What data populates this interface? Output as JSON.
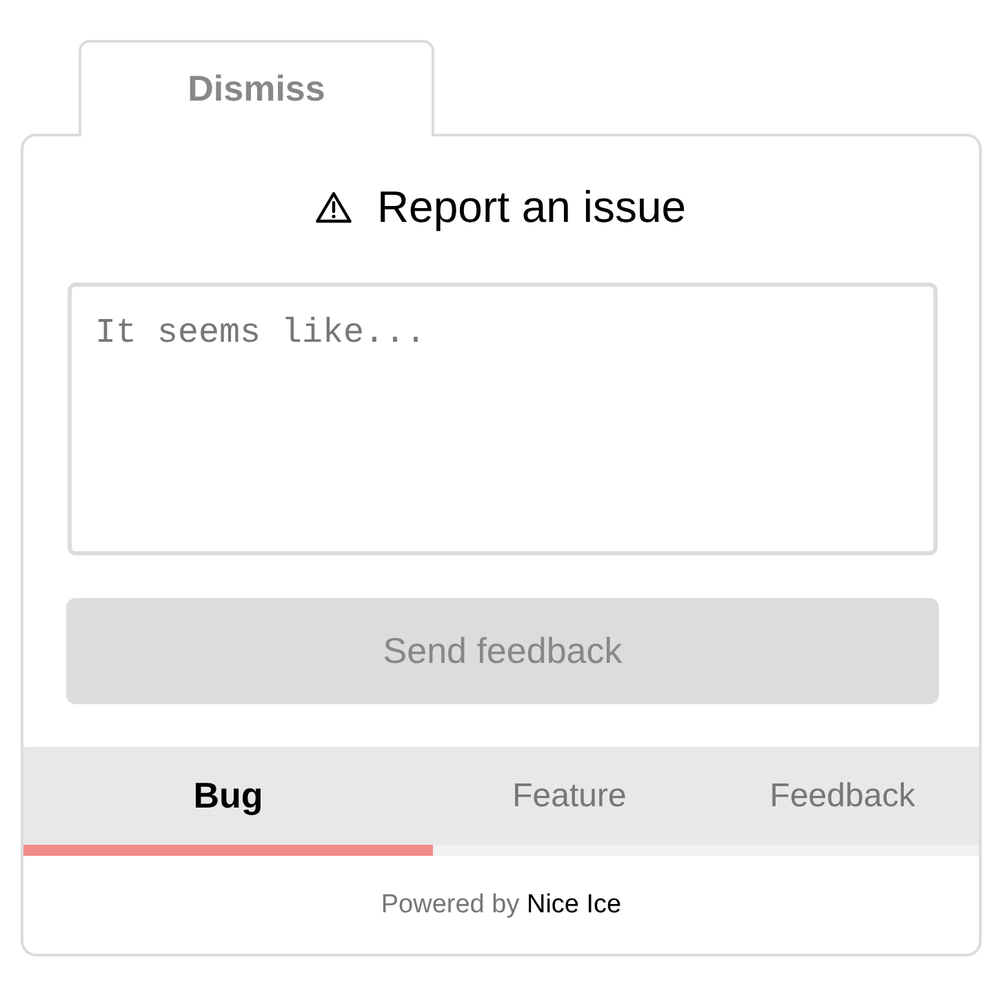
{
  "dismiss_tab": {
    "label": "Dismiss"
  },
  "title": "Report an issue",
  "message_field": {
    "placeholder": "It seems like..."
  },
  "send_button": {
    "label": "Send feedback",
    "disabled": true
  },
  "tabs": [
    {
      "label": "Bug",
      "selected": true
    },
    {
      "label": "Feature",
      "selected": false
    },
    {
      "label": "Feedback",
      "selected": false
    }
  ],
  "footer": {
    "text": "Powered by",
    "link": "Nice Ice"
  }
}
